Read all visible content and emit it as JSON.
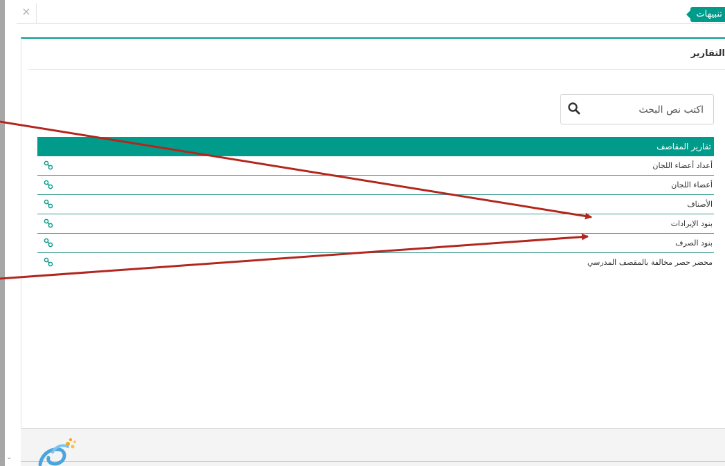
{
  "header": {
    "close_symbol": "×",
    "alerts_tab": "تنبيهات"
  },
  "panel": {
    "title": "التقارير"
  },
  "search": {
    "placeholder": "اكتب نص البحث"
  },
  "table": {
    "header": "تقارير المقاصف",
    "rows": [
      {
        "label": "أعداد أعضاء اللجان",
        "icon": "link-icon"
      },
      {
        "label": "أعضاء اللجان",
        "icon": "link-icon"
      },
      {
        "label": "الأصناف",
        "icon": "link-icon"
      },
      {
        "label": "بنود الإيرادات",
        "icon": "link-icon"
      },
      {
        "label": "بنود الصرف",
        "icon": "link-icon"
      },
      {
        "label": "محضر حصر مخالفة بالمقصف المدرسي",
        "icon": "link-icon"
      }
    ]
  },
  "footer": {
    "logo": "app-logo"
  },
  "colors": {
    "accent": "#009b8a",
    "annotation_arrow": "#b3261e"
  },
  "icons": [
    "close-icon",
    "search-icon",
    "link-icon",
    "chevron-down-icon",
    "app-logo"
  ]
}
